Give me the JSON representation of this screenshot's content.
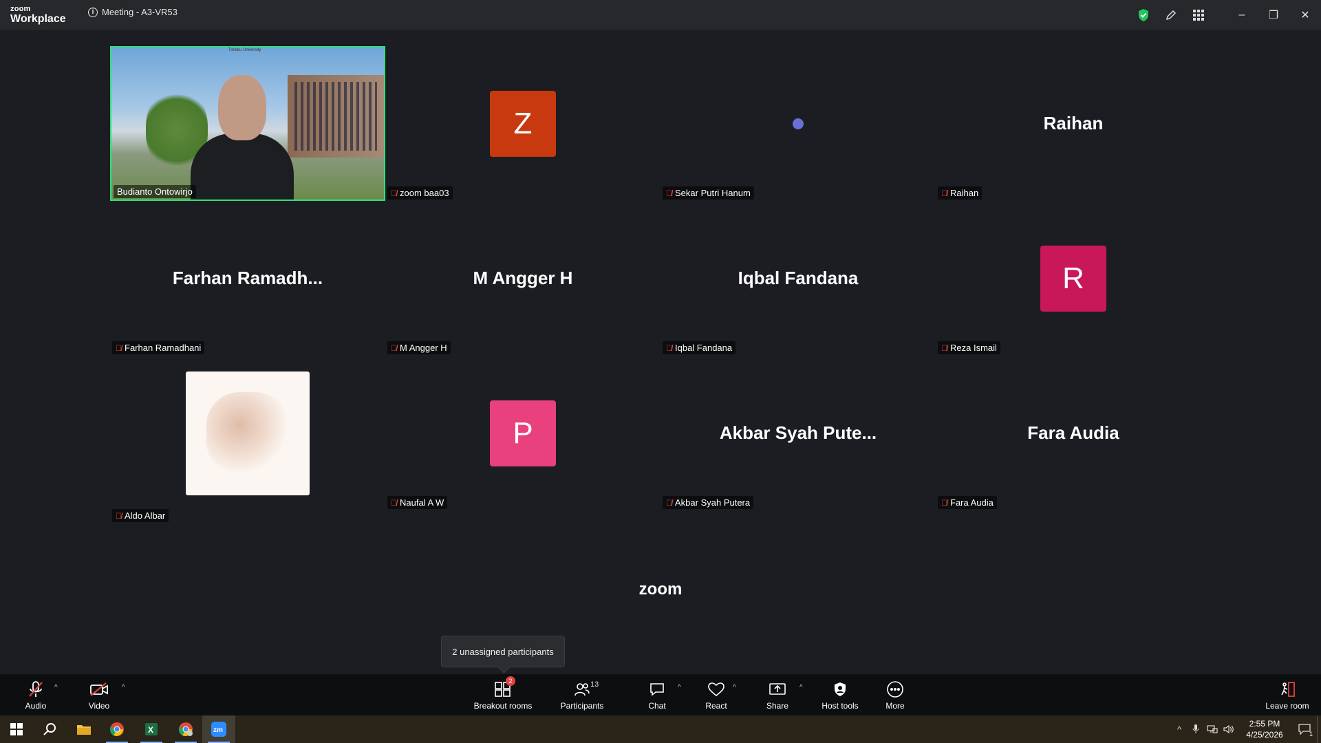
{
  "window": {
    "brand_line1": "zoom",
    "brand_line2": "Workplace",
    "meeting_title": "Meeting - A3-VR53",
    "minimize": "–",
    "restore": "❐",
    "close": "✕"
  },
  "participants": [
    {
      "name": "Budianto Ontowirjo",
      "type": "video",
      "muted": false,
      "active_speaker": true,
      "video_caption": "Tohoku University"
    },
    {
      "name": "zoom baa03",
      "type": "avatar",
      "initial": "Z",
      "color": "#c8390f",
      "muted": true
    },
    {
      "name": "Sekar Putri Hanum",
      "type": "dot",
      "muted": true
    },
    {
      "name": "Raihan",
      "type": "text",
      "display": "Raihan",
      "muted": true
    },
    {
      "name": "Farhan Ramadhani",
      "type": "text",
      "display": "Farhan  Ramadh...",
      "muted": true
    },
    {
      "name": "M Angger H",
      "type": "text",
      "display": "M Angger H",
      "muted": true
    },
    {
      "name": "Iqbal Fandana",
      "type": "text",
      "display": "Iqbal Fandana",
      "muted": true
    },
    {
      "name": "Reza Ismail",
      "type": "avatar",
      "initial": "R",
      "color": "#c8185a",
      "muted": true
    },
    {
      "name": "Aldo Albar",
      "type": "image",
      "muted": true
    },
    {
      "name": "Naufal A W",
      "type": "avatar",
      "initial": "P",
      "color": "#e8417d",
      "muted": true
    },
    {
      "name": "Akbar Syah Putera",
      "type": "text",
      "display": "Akbar Syah Pute...",
      "muted": true
    },
    {
      "name": "Fara Audia",
      "type": "text",
      "display": "Fara Audia",
      "muted": true
    }
  ],
  "watermark": "zoom",
  "tooltip": "2 unassigned participants",
  "toolbar": {
    "audio": "Audio",
    "video": "Video",
    "breakout": "Breakout rooms",
    "breakout_badge": "2",
    "participants": "Participants",
    "participants_count": "13",
    "chat": "Chat",
    "react": "React",
    "share": "Share",
    "host_tools": "Host tools",
    "more": "More",
    "leave": "Leave room"
  },
  "taskbar": {
    "time": "2:55 PM",
    "date": "4/25/2026",
    "notification_count": "1",
    "apps": [
      "start",
      "search",
      "file-explorer",
      "chrome",
      "excel",
      "chrome-profile",
      "zoom"
    ]
  },
  "colors": {
    "active_border": "#2ee37b",
    "mute_red": "#e0443e",
    "shield_green": "#23c55e"
  }
}
